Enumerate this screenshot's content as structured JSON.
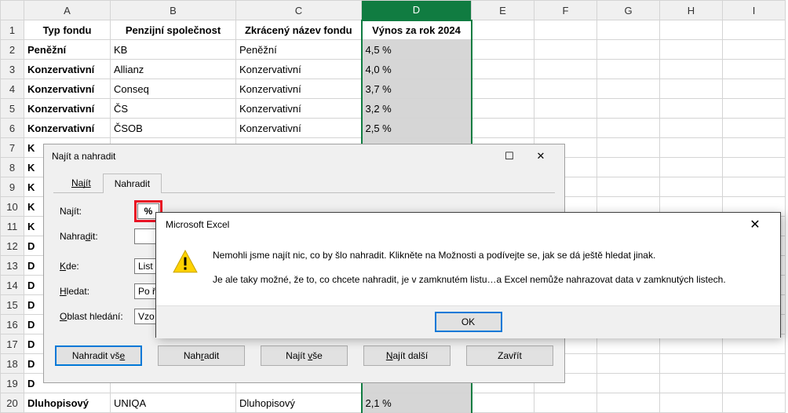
{
  "columns": [
    "A",
    "B",
    "C",
    "D",
    "E",
    "F",
    "G",
    "H",
    "I"
  ],
  "headerRow": {
    "A": "Typ fondu",
    "B": "Penzijní společnost",
    "C": "Zkrácený název fondu",
    "D": "Výnos za rok 2024"
  },
  "rows": [
    {
      "n": 2,
      "A": "Peněžní",
      "B": "KB",
      "C": "Peněžní",
      "D": "4,5 %"
    },
    {
      "n": 3,
      "A": "Konzervativní",
      "B": "Allianz",
      "C": "Konzervativní",
      "D": "4,0 %"
    },
    {
      "n": 4,
      "A": "Konzervativní",
      "B": "Conseq",
      "C": "Konzervativní",
      "D": "3,7 %"
    },
    {
      "n": 5,
      "A": "Konzervativní",
      "B": "ČS",
      "C": "Konzervativní",
      "D": "3,2 %"
    },
    {
      "n": 6,
      "A": "Konzervativní",
      "B": "ČSOB",
      "C": "Konzervativní",
      "D": "2,5 %"
    },
    {
      "n": 7,
      "A": "K",
      "B": "",
      "C": "",
      "D": ""
    },
    {
      "n": 8,
      "A": "K",
      "B": "",
      "C": "",
      "D": ""
    },
    {
      "n": 9,
      "A": "K",
      "B": "",
      "C": "",
      "D": ""
    },
    {
      "n": 10,
      "A": "K",
      "B": "",
      "C": "",
      "D": ""
    },
    {
      "n": 11,
      "A": "K",
      "B": "",
      "C": "",
      "D": ""
    },
    {
      "n": 12,
      "A": "D",
      "B": "",
      "C": "",
      "D": ""
    },
    {
      "n": 13,
      "A": "D",
      "B": "",
      "C": "",
      "D": ""
    },
    {
      "n": 14,
      "A": "D",
      "B": "",
      "C": "",
      "D": ""
    },
    {
      "n": 15,
      "A": "D",
      "B": "",
      "C": "",
      "D": ""
    },
    {
      "n": 16,
      "A": "D",
      "B": "",
      "C": "",
      "D": ""
    },
    {
      "n": 17,
      "A": "D",
      "B": "",
      "C": "",
      "D": ""
    },
    {
      "n": 18,
      "A": "D",
      "B": "",
      "C": "",
      "D": ""
    },
    {
      "n": 19,
      "A": "D",
      "B": "",
      "C": "",
      "D": ""
    },
    {
      "n": 20,
      "A": "Dluhopisový",
      "B": "UNIQA",
      "C": "Dluhopisový",
      "D": "2,1 %"
    }
  ],
  "findReplace": {
    "title": "Najít a nahradit",
    "tabs": {
      "find": "Najít",
      "replace": "Nahradit"
    },
    "labels": {
      "find": "Najít:",
      "replace": "Nahradit:",
      "where": "Kde:",
      "search": "Hledat:",
      "lookin": "Oblast hledání:"
    },
    "values": {
      "find": "%",
      "replace": "",
      "where": "List",
      "search": "Po ř",
      "lookin": "Vzo"
    },
    "buttons": {
      "replaceAll": "Nahradit vše",
      "replace": "Nahradit",
      "findAll": "Najít vše",
      "findNext": "Najít další",
      "close": "Zavřít"
    }
  },
  "msgbox": {
    "title": "Microsoft Excel",
    "line1": "Nemohli jsme najít nic, co by šlo nahradit. Klikněte na Možnosti a podívejte se, jak se dá ještě hledat jinak.",
    "line2": "Je ale taky možné, že to, co chcete nahradit, je v zamknutém listu…a Excel nemůže nahrazovat data v zamknutých listech.",
    "ok": "OK"
  }
}
